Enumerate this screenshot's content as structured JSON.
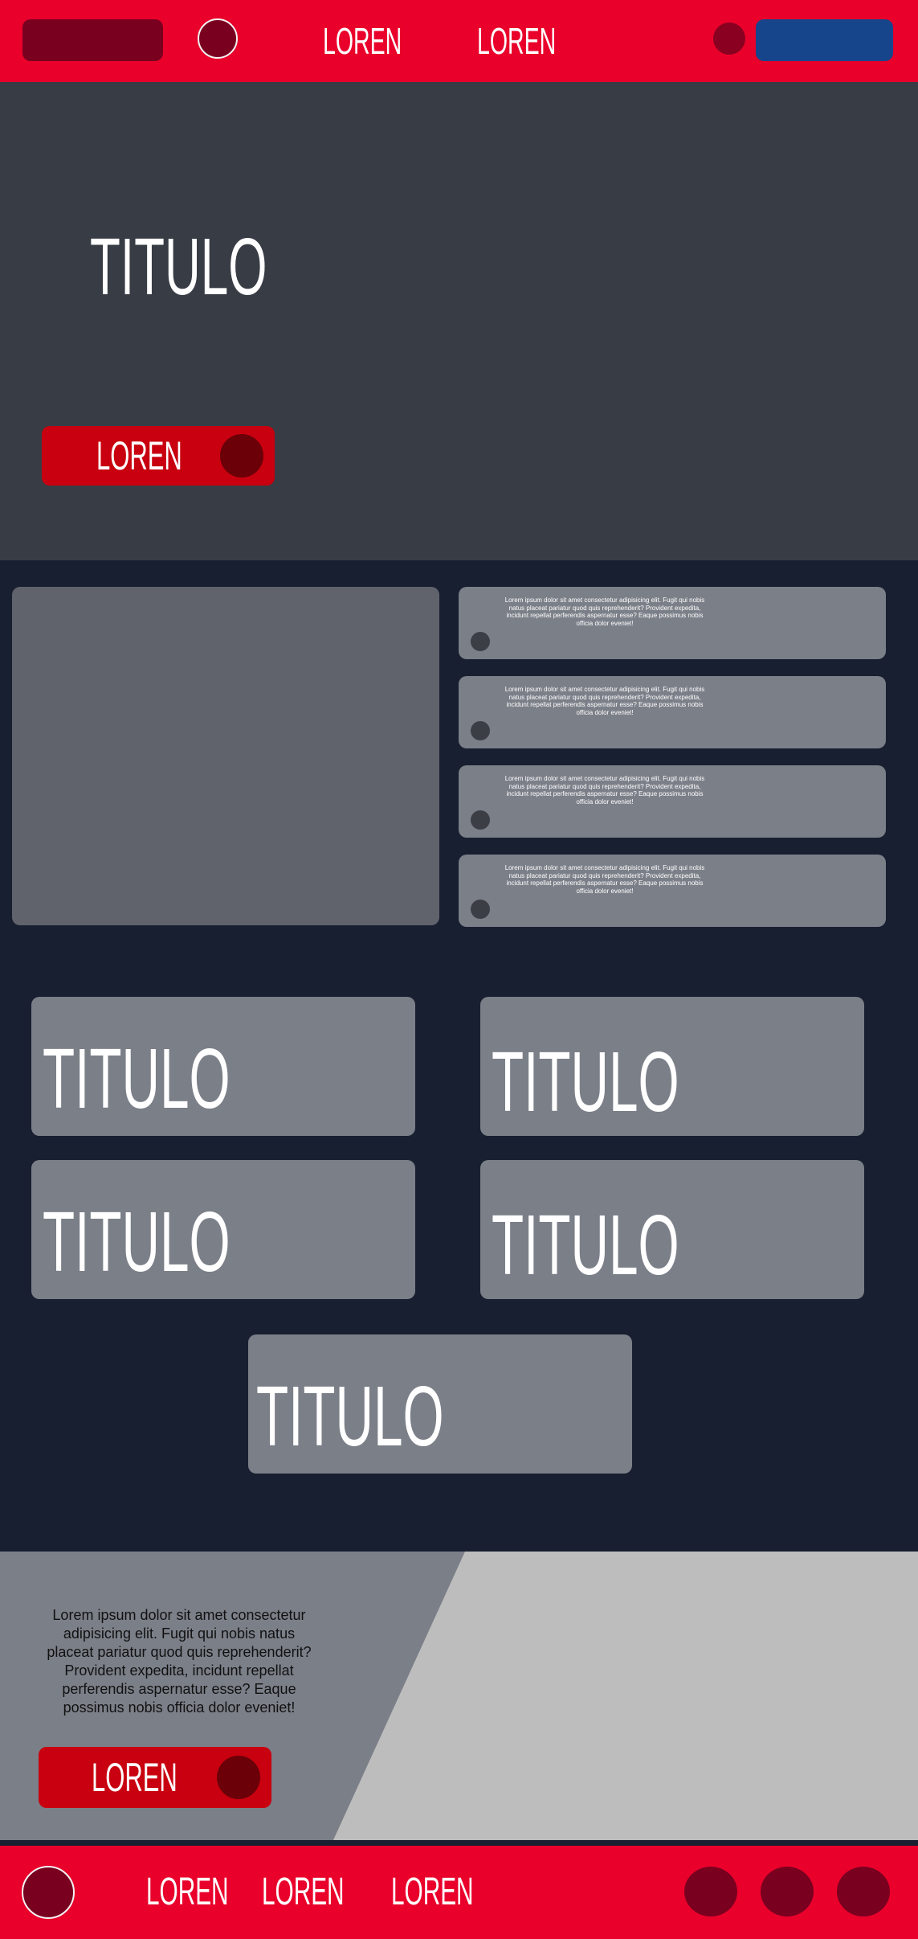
{
  "header": {
    "links": [
      "LOREN",
      "LOREN"
    ]
  },
  "hero": {
    "title": "TITULO",
    "button_label": "LOREN"
  },
  "features": {
    "cards": [
      "Lorem ipsum dolor sit amet consectetur adipisicing elit. Fugit qui nobis natus placeat pariatur quod quis reprehenderit? Provident expedita, incidunt repellat perferendis aspernatur esse? Eaque possimus nobis officia dolor eveniet!",
      "Lorem ipsum dolor sit amet consectetur adipisicing elit. Fugit qui nobis natus placeat pariatur quod quis reprehenderit? Provident expedita, incidunt repellat perferendis aspernatur esse? Eaque possimus nobis officia dolor eveniet!",
      "Lorem ipsum dolor sit amet consectetur adipisicing elit. Fugit qui nobis natus placeat pariatur quod quis reprehenderit? Provident expedita, incidunt repellat perferendis aspernatur esse? Eaque possimus nobis officia dolor eveniet!",
      "Lorem ipsum dolor sit amet consectetur adipisicing elit. Fugit qui nobis natus placeat pariatur quod quis reprehenderit? Provident expedita, incidunt repellat perferendis aspernatur esse? Eaque possimus nobis officia dolor eveniet!"
    ]
  },
  "tiles": [
    "TITULO",
    "TITULO",
    "TITULO",
    "TITULO",
    "TITULO"
  ],
  "banner": {
    "text": "Lorem ipsum dolor sit amet consectetur adipisicing elit. Fugit qui nobis natus placeat pariatur quod quis reprehenderit? Provident expedita, incidunt repellat perferendis aspernatur esse? Eaque possimus nobis officia dolor eveniet!",
    "button_label": "LOREN"
  },
  "footer": {
    "links": [
      "LOREN",
      "LOREN",
      "LOREN"
    ]
  },
  "colors": {
    "brand_red": "#e9002b",
    "dark_red": "#7a0020",
    "button_red": "#c8000f",
    "accent_blue": "#17458c",
    "hero_bg": "#383c45",
    "page_bg": "#181f31",
    "card_gray": "#7b7f88"
  },
  "icons": {
    "header_logo": "circle-logo-icon",
    "header_dot": "circle-icon",
    "button_dot": "circle-icon",
    "card_dot": "circle-icon",
    "footer_logo": "circle-logo-icon",
    "footer_social": [
      "social-icon",
      "social-icon",
      "social-icon"
    ]
  }
}
